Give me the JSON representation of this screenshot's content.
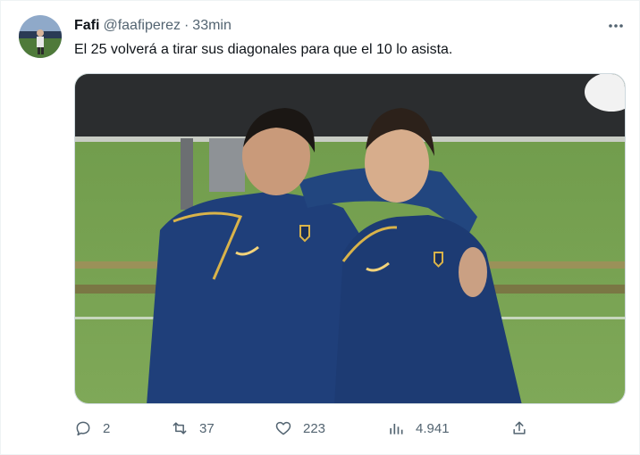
{
  "tweet": {
    "author_name": "Fafi",
    "author_handle": "@faafiperez",
    "separator": "·",
    "timestamp": "33min",
    "text": "El 25 volverá a tirar sus diagonales para que el 10 lo asista.",
    "more_icon": "more-horizontal-icon",
    "media_description": "photo-two-players-blue-training-tops",
    "actions": {
      "reply": {
        "icon": "reply-icon",
        "count": "2"
      },
      "retweet": {
        "icon": "retweet-icon",
        "count": "37"
      },
      "like": {
        "icon": "heart-icon",
        "count": "223"
      },
      "views": {
        "icon": "views-bar-chart-icon",
        "count": "4.941"
      },
      "share": {
        "icon": "share-icon"
      }
    }
  },
  "colors": {
    "text_primary": "#0f1419",
    "text_secondary": "#536471",
    "border": "#cfd9de",
    "jersey_blue": "#1f3f7a",
    "jersey_gold": "#d9b34a"
  }
}
